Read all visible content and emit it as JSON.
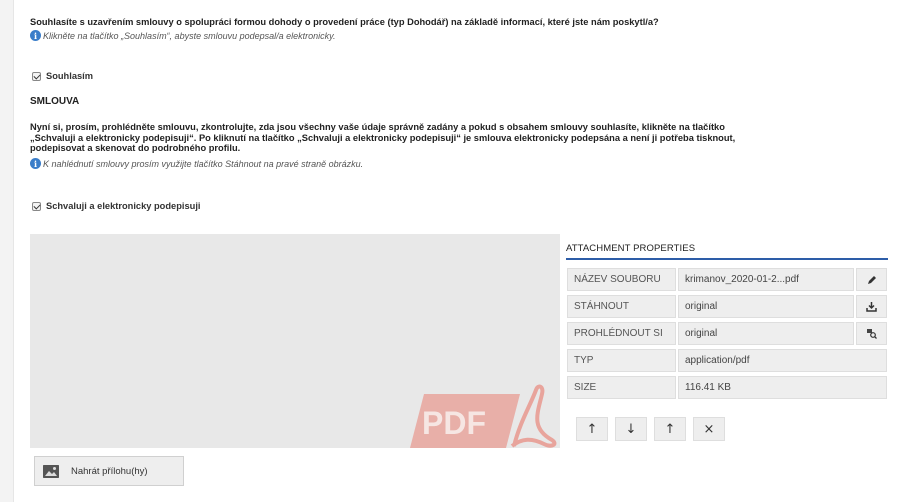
{
  "agreement": {
    "question": "Souhlasíte s uzavřením smlouvy o spolupráci formou dohody o provedení práce (typ Dohodář) na základě informací, které jste nám poskytl/a?",
    "hint": "Klikněte na tlačítko „Souhlasím“, abyste smlouvu podepsal/a elektronicky.",
    "agree_label": "Souhlasím",
    "agree_checked": true
  },
  "contract": {
    "title": "SMLOUVA",
    "paragraph_line1": "Nyní si, prosím, prohlédněte smlouvu, zkontrolujte, zda jsou všechny vaše údaje správně zadány a pokud s obsahem smlouvy souhlasíte, klikněte na tlačítko",
    "paragraph_line2": "„Schvaluji a elektronicky podepisuji“. Po kliknutí na tlačítko „Schvaluji a elektronicky podepisuji“ je smlouva elektronicky podepsána a není ji potřeba tisknout,",
    "paragraph_line3": "podepisovat a skenovat do podrobného profilu.",
    "hint": "K nahlédnutí smlouvy prosím využijte tlačítko Stáhnout na pravé straně obrázku.",
    "sign_label": "Schvaluji a elektronicky podepisuji",
    "sign_checked": true
  },
  "attachment": {
    "preview_logo_text": "PDF",
    "properties_title": "ATTACHMENT PROPERTIES",
    "rows": [
      {
        "key": "NÁZEV SOUBORU",
        "value": "krimanov_2020-01-2...pdf",
        "action_icon": "pencil-icon"
      },
      {
        "key": "STÁHNOUT",
        "value": "original",
        "action_icon": "download-icon"
      },
      {
        "key": "PROHLÉDNOUT SI",
        "value": "original",
        "action_icon": "preview-icon"
      },
      {
        "key": "TYP",
        "value": "application/pdf"
      },
      {
        "key": "SIZE",
        "value": "116.41 KB"
      }
    ],
    "move_buttons": [
      "↑",
      "↓",
      "↑",
      "×"
    ]
  },
  "upload": {
    "label": "Nahrát přílohu(hy)"
  },
  "colors": {
    "accent": "#2d5da8",
    "pdf_logo": "#e8a49c",
    "info_icon": "#3a7dc9"
  }
}
